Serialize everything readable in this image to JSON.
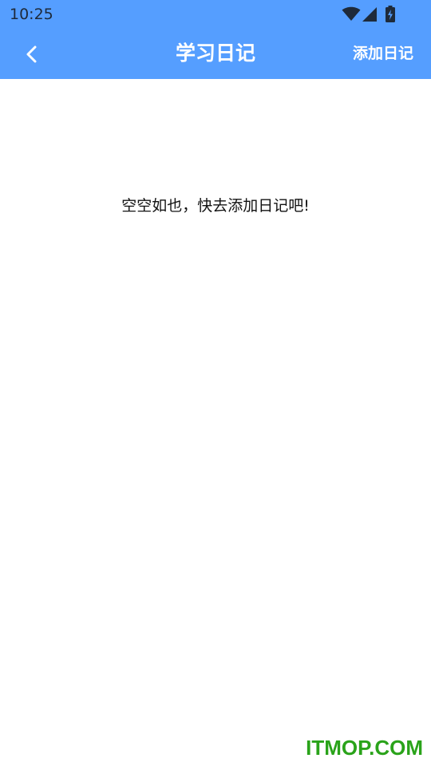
{
  "status_bar": {
    "time": "10:25",
    "icons": [
      "wifi-icon",
      "cellular-signal-icon",
      "battery-charging-icon"
    ]
  },
  "header": {
    "back_icon": "chevron-left-icon",
    "title": "学习日记",
    "add_label": "添加日记"
  },
  "main": {
    "empty_message": "空空如也，快去添加日记吧!"
  },
  "watermark": {
    "text": "ITMOP.COM"
  },
  "colors": {
    "header_blue": "#559eff",
    "background": "#ffffff",
    "watermark_green": "#2aa31a"
  }
}
